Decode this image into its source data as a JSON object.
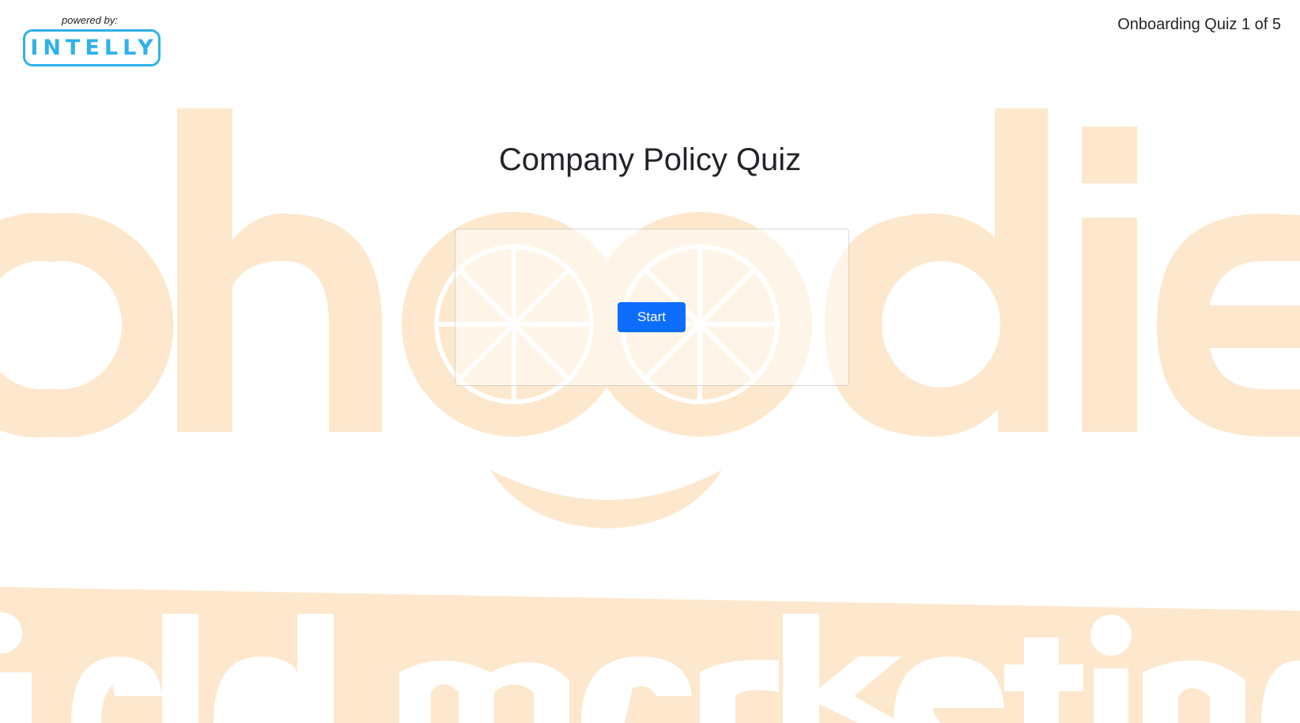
{
  "header": {
    "powered_by": "powered by:",
    "logo_text": "INTELLY",
    "progress": "Onboarding Quiz 1 of 5"
  },
  "main": {
    "title": "Company Policy Quiz",
    "start_label": "Start"
  },
  "background": {
    "watermark_top": "oheedie",
    "watermark_bottom": "field marketing",
    "watermark_color": "#fde8cd"
  },
  "colors": {
    "brand": "#2fb2ea",
    "primary_button": "#0d6efd",
    "text": "#212529"
  }
}
